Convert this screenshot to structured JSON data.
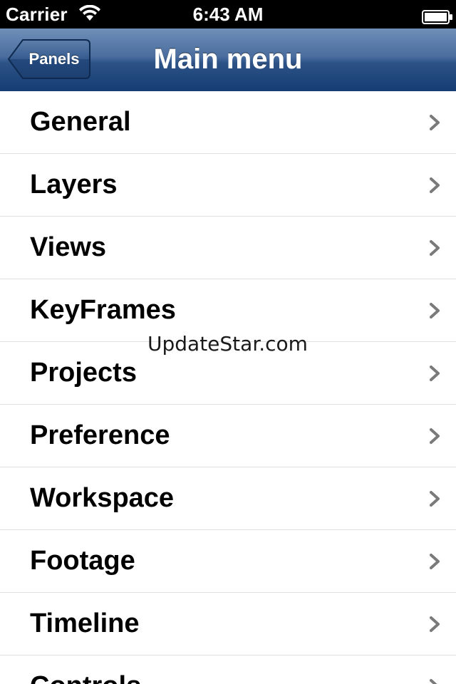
{
  "status_bar": {
    "carrier": "Carrier",
    "time": "6:43 AM",
    "wifi_icon": "wifi-icon",
    "battery_icon": "battery-icon"
  },
  "nav_bar": {
    "back_label": "Panels",
    "title": "Main menu",
    "colors": {
      "gradient_top": "#6f8fb8",
      "gradient_bottom": "#163e74"
    }
  },
  "menu": {
    "items": [
      {
        "label": "General"
      },
      {
        "label": "Layers"
      },
      {
        "label": "Views"
      },
      {
        "label": "KeyFrames"
      },
      {
        "label": "Projects"
      },
      {
        "label": "Preference"
      },
      {
        "label": "Workspace"
      },
      {
        "label": "Footage"
      },
      {
        "label": "Timeline"
      },
      {
        "label": "Controls"
      }
    ],
    "disclosure_icon": "chevron-right-icon"
  },
  "watermark": "UpdateStar.com"
}
